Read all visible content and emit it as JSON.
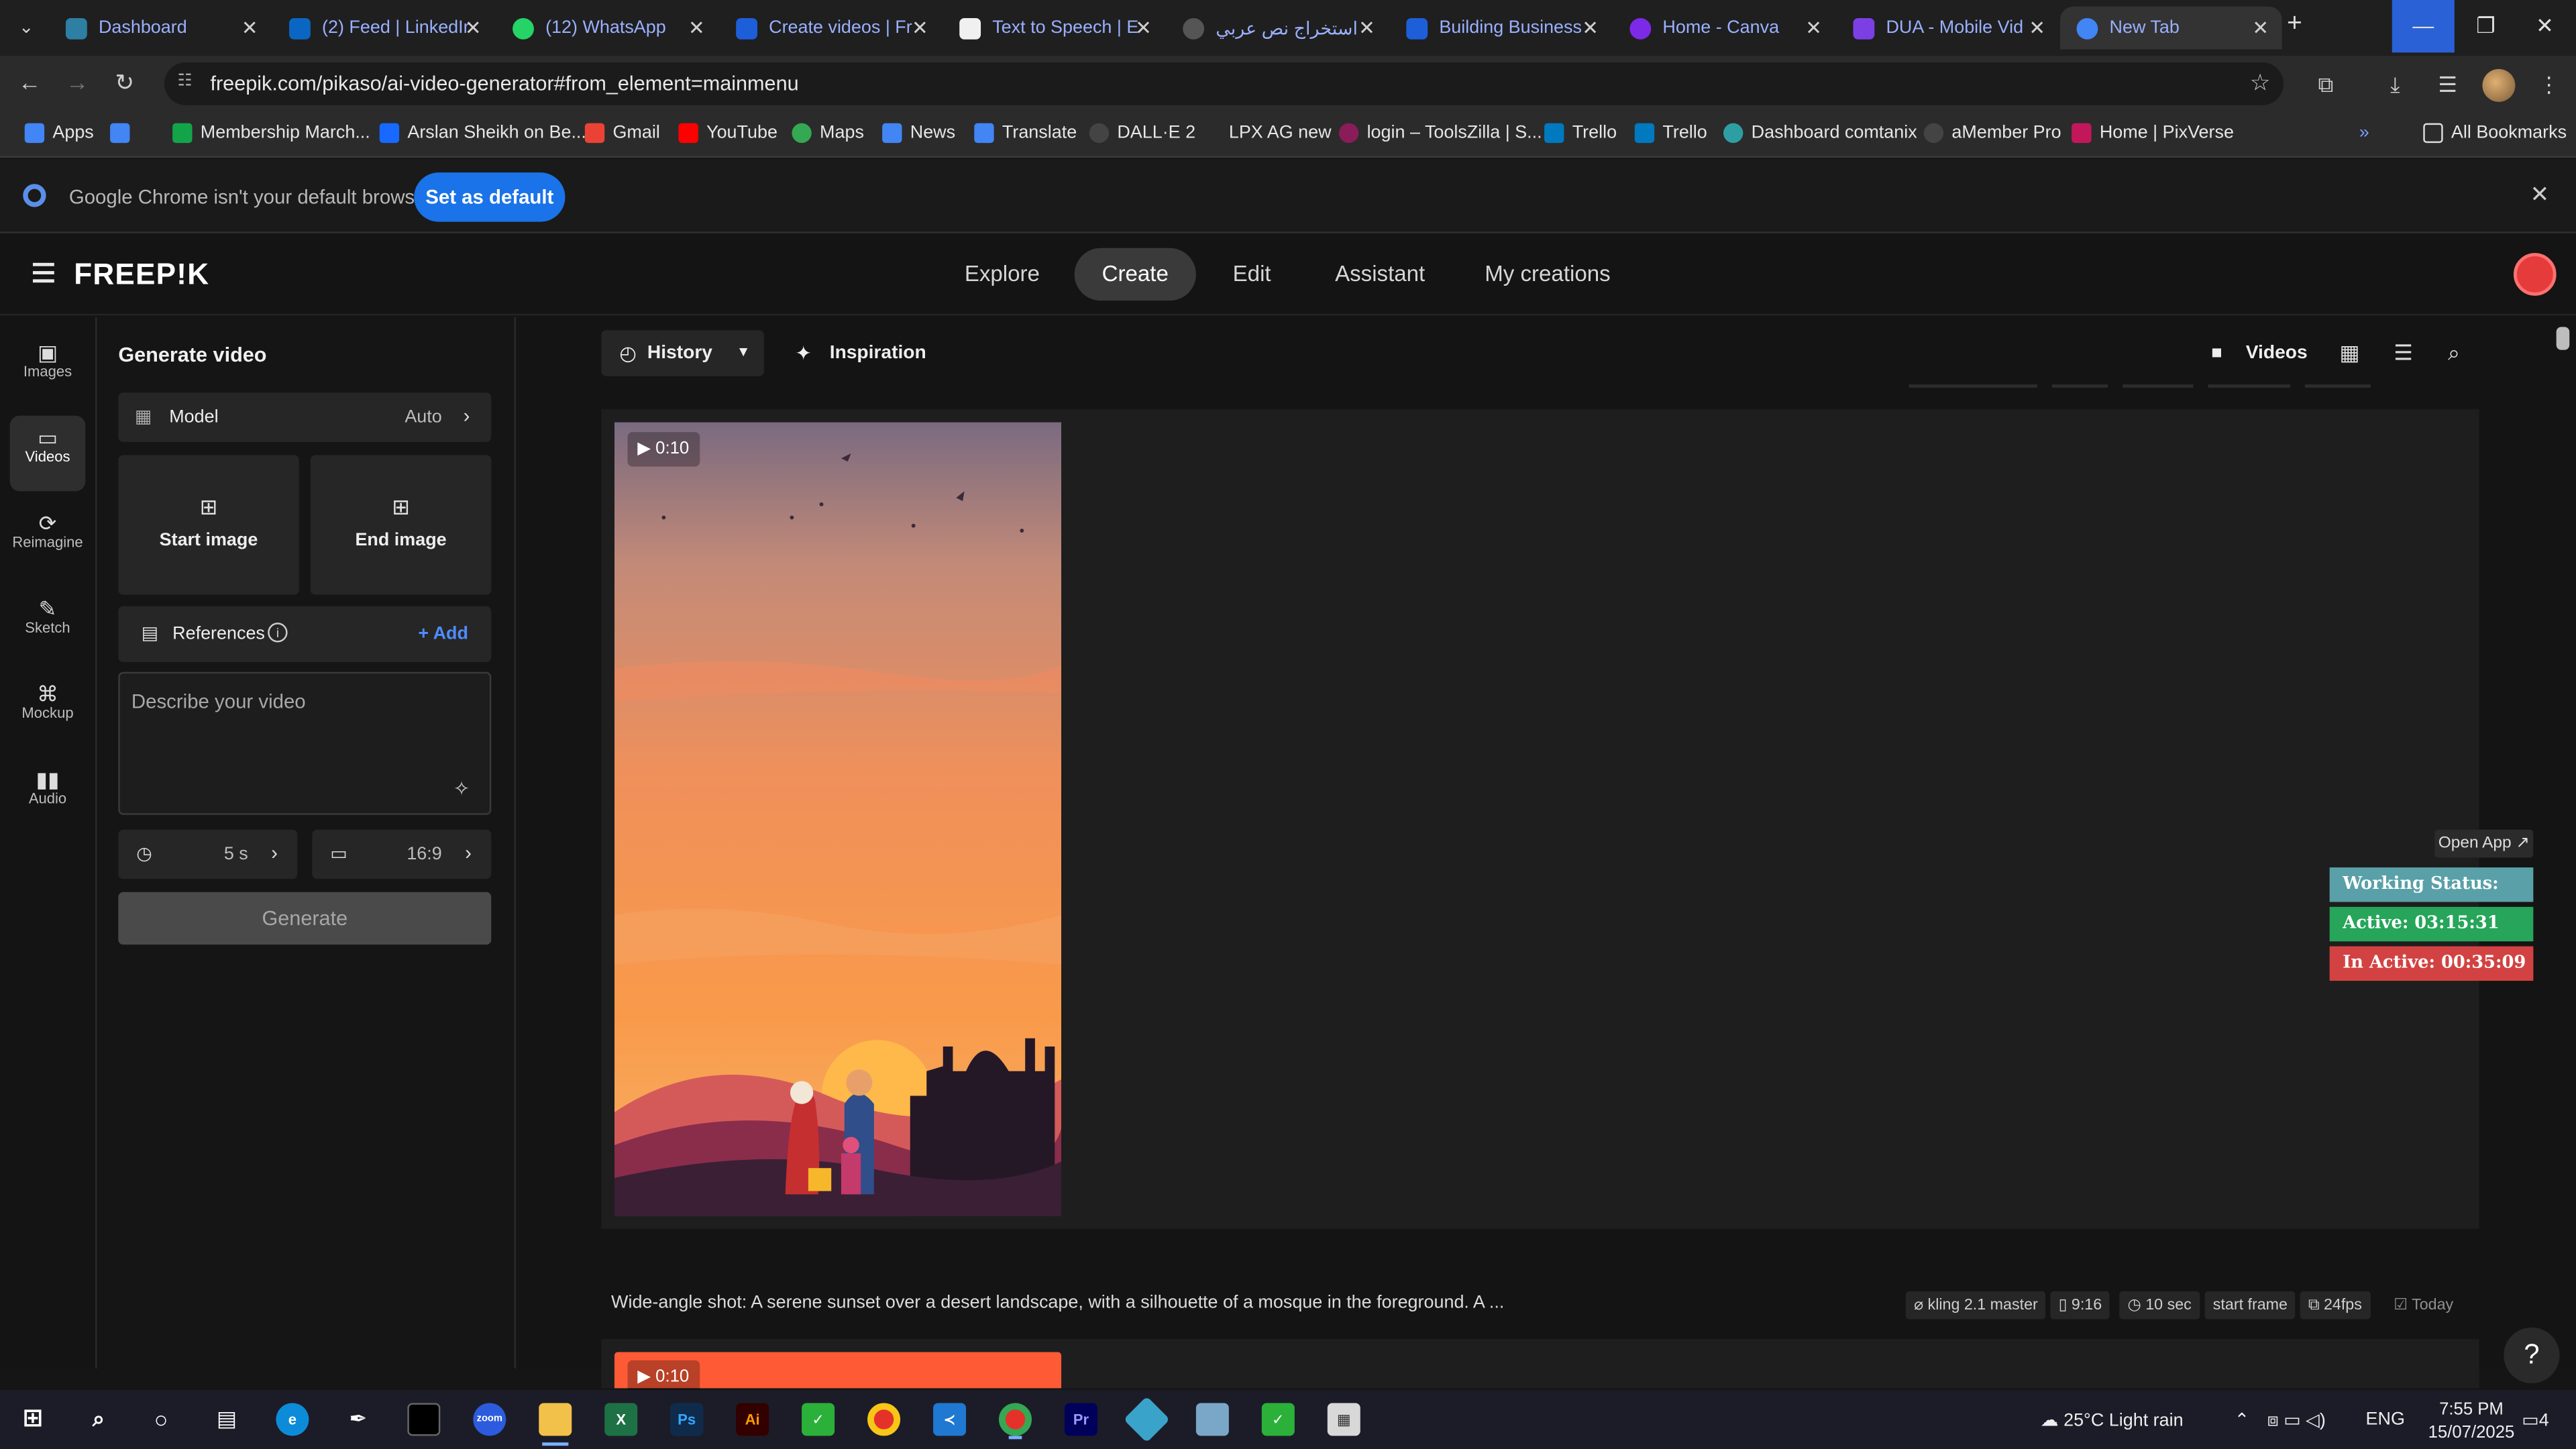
{
  "browser": {
    "tabs": [
      {
        "title": "Dashboard",
        "color": "#2d7fa3"
      },
      {
        "title": "(2) Feed | LinkedIn",
        "color": "#0a66c2"
      },
      {
        "title": "(12) WhatsApp",
        "color": "#25d366"
      },
      {
        "title": "Create videos | Fr",
        "color": "#1d5fd9"
      },
      {
        "title": "Text to Speech | E",
        "color": "#111111"
      },
      {
        "title": "استخراج نص عربي",
        "color": "#333333"
      },
      {
        "title": "Building Business",
        "color": "#1d5fd9"
      },
      {
        "title": "Home - Canva",
        "color": "#7d2ae8"
      },
      {
        "title": "DUA - Mobile Vid",
        "color": "#7b3fe4"
      },
      {
        "title": "New Tab",
        "color": "#4285f4"
      }
    ],
    "url": "freepik.com/pikaso/ai-video-generator#from_element=mainmenu",
    "bookmarks": [
      {
        "label": "Apps",
        "color": "#4285f4"
      },
      {
        "label": "",
        "color": "#4285f4"
      },
      {
        "label": "Membership March...",
        "color": "#13a44a"
      },
      {
        "label": "Arslan Sheikh on Be...",
        "color": "#1769ff"
      },
      {
        "label": "Gmail",
        "color": "#ea4335"
      },
      {
        "label": "YouTube",
        "color": "#ff0000"
      },
      {
        "label": "Maps",
        "color": "#34a853"
      },
      {
        "label": "News",
        "color": "#4285f4"
      },
      {
        "label": "Translate",
        "color": "#4285f4"
      },
      {
        "label": "DALL·E 2",
        "color": "#444444"
      },
      {
        "label": "LPX AG new",
        "color": "#2b2b2b"
      },
      {
        "label": "login – ToolsZilla | S...",
        "color": "#8a1c5a"
      },
      {
        "label": "Trello",
        "color": "#0079bf"
      },
      {
        "label": "Trello",
        "color": "#0079bf"
      },
      {
        "label": "Dashboard comtanix",
        "color": "#2d9fa3"
      },
      {
        "label": "aMember Pro",
        "color": "#444444"
      },
      {
        "label": "Home | PixVerse",
        "color": "#c2185b"
      }
    ],
    "all_bookmarks": "All Bookmarks",
    "info_message": "Google Chrome isn't your default browser",
    "set_default": "Set as default"
  },
  "app": {
    "logo": "FREEP!K",
    "nav": [
      {
        "label": "Explore"
      },
      {
        "label": "Create"
      },
      {
        "label": "Edit"
      },
      {
        "label": "Assistant"
      },
      {
        "label": "My creations"
      }
    ],
    "active_nav": "Create"
  },
  "rail": [
    {
      "label": "Images",
      "icon": "images-icon"
    },
    {
      "label": "Videos",
      "icon": "videos-icon"
    },
    {
      "label": "Reimagine",
      "icon": "reimagine-icon"
    },
    {
      "label": "Sketch",
      "icon": "sketch-icon"
    },
    {
      "label": "Mockup",
      "icon": "mockup-icon"
    },
    {
      "label": "Audio",
      "icon": "audio-icon"
    }
  ],
  "panel": {
    "title": "Generate video",
    "model_label": "Model",
    "model_value": "Auto",
    "start_image": "Start image",
    "end_image": "End image",
    "references_label": "References",
    "add_label": "+ Add",
    "prompt_placeholder": "Describe your video",
    "duration": "5 s",
    "aspect": "16:9",
    "generate": "Generate"
  },
  "toolbar": {
    "history": "History",
    "inspiration": "Inspiration",
    "videos": "Videos"
  },
  "results": {
    "duration_badge": "0:10",
    "caption": "Wide-angle shot: A serene sunset over a desert landscape, with a silhouette of a mosque in the foreground. A ...",
    "meta": {
      "model": "kling 2.1 master",
      "ratio": "9:16",
      "length": "10 sec",
      "frame": "start frame",
      "fps": "24fps",
      "date": "Today"
    },
    "second_badge": "0:10"
  },
  "overlay": {
    "open_app": "Open App ↗",
    "working_status": "Working Status: Active",
    "active": "Active: 03:15:31",
    "inactive": "In Active: 00:35:09"
  },
  "taskbar": {
    "weather": "25°C  Light rain",
    "lang": "ENG",
    "time": "7:55 PM",
    "date": "15/07/2025",
    "notifications": "4"
  }
}
